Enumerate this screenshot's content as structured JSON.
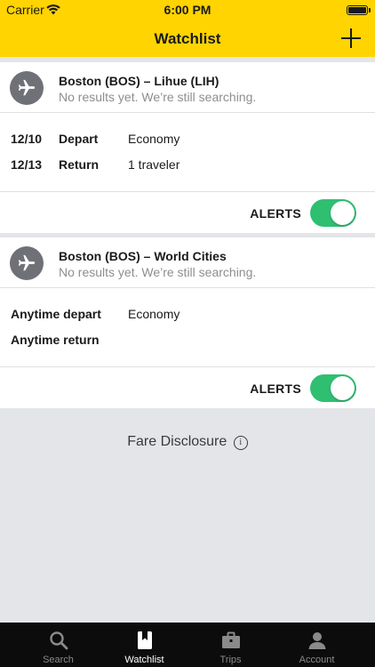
{
  "status": {
    "carrier": "Carrier",
    "time": "6:00 PM"
  },
  "nav": {
    "title": "Watchlist"
  },
  "watchlist": [
    {
      "route": "Boston (BOS) – Lihue (LIH)",
      "status": "No results yet. We’re still searching.",
      "rows": [
        {
          "date": "12/10",
          "leg": "Depart",
          "info": "Economy"
        },
        {
          "date": "12/13",
          "leg": "Return",
          "info": "1 traveler"
        }
      ],
      "alerts_label": "ALERTS",
      "alerts_on": true
    },
    {
      "route": "Boston (BOS) – World Cities",
      "status": "No results yet. We’re still searching.",
      "rows": [
        {
          "leg": "Anytime depart",
          "info": "Economy"
        },
        {
          "leg": "Anytime return",
          "info": ""
        }
      ],
      "alerts_label": "ALERTS",
      "alerts_on": true
    }
  ],
  "footer": {
    "fare_disclosure": "Fare Disclosure",
    "info_glyph": "i"
  },
  "tabs": [
    {
      "label": "Search",
      "icon": "search-icon"
    },
    {
      "label": "Watchlist",
      "icon": "bookmark-icon",
      "active": true
    },
    {
      "label": "Trips",
      "icon": "briefcase-icon"
    },
    {
      "label": "Account",
      "icon": "person-icon"
    }
  ],
  "colors": {
    "header": "#ffd400",
    "toggle_on": "#2fbf71",
    "tabbar": "#0c0c0c",
    "plane_circle": "#6f7177"
  }
}
